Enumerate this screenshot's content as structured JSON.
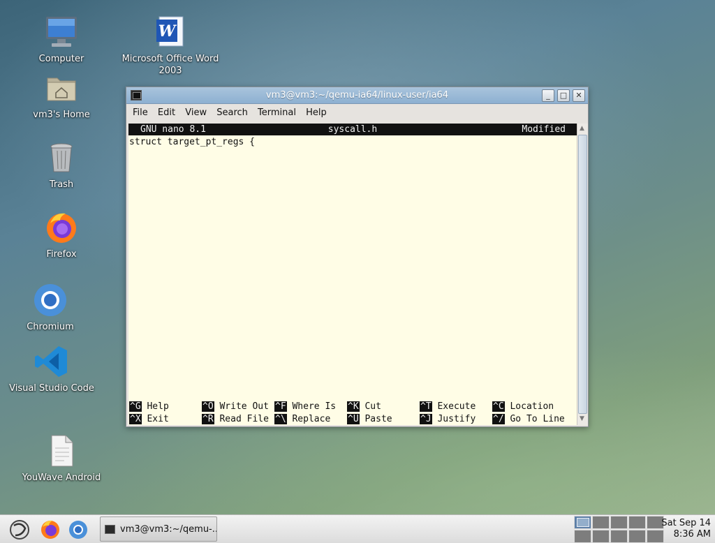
{
  "desktop": {
    "icons": [
      {
        "label": "Computer"
      },
      {
        "label": "Microsoft Office Word 2003"
      },
      {
        "label": "vm3's Home"
      },
      {
        "label": "Trash"
      },
      {
        "label": "Firefox"
      },
      {
        "label": "Chromium"
      },
      {
        "label": "Visual Studio Code"
      },
      {
        "label": "YouWave Android"
      }
    ]
  },
  "window": {
    "title": "vm3@vm3:~/qemu-ia64/linux-user/ia64",
    "menu": [
      "File",
      "Edit",
      "View",
      "Search",
      "Terminal",
      "Help"
    ],
    "nano": {
      "version": "GNU nano 8.1",
      "filename": "syscall.h",
      "status": "Modified",
      "lines": [
        "struct target_pt_regs {"
      ],
      "shortcuts_row1": [
        {
          "key": "^G",
          "label": "Help"
        },
        {
          "key": "^O",
          "label": "Write Out"
        },
        {
          "key": "^F",
          "label": "Where Is"
        },
        {
          "key": "^K",
          "label": "Cut"
        },
        {
          "key": "^T",
          "label": "Execute"
        },
        {
          "key": "^C",
          "label": "Location"
        }
      ],
      "shortcuts_row2": [
        {
          "key": "^X",
          "label": "Exit"
        },
        {
          "key": "^R",
          "label": "Read File"
        },
        {
          "key": "^\\",
          "label": "Replace"
        },
        {
          "key": "^U",
          "label": "Paste"
        },
        {
          "key": "^J",
          "label": "Justify"
        },
        {
          "key": "^/",
          "label": "Go To Line"
        }
      ]
    }
  },
  "taskbar": {
    "task_label": "vm3@vm3:~/qemu-...",
    "clock": {
      "date": "Sat Sep 14",
      "time": "8:36 AM"
    }
  },
  "colors": {
    "titlebar": "#8db0d1",
    "terminal_bg": "#fffde6",
    "nano_bar": "#111111"
  }
}
